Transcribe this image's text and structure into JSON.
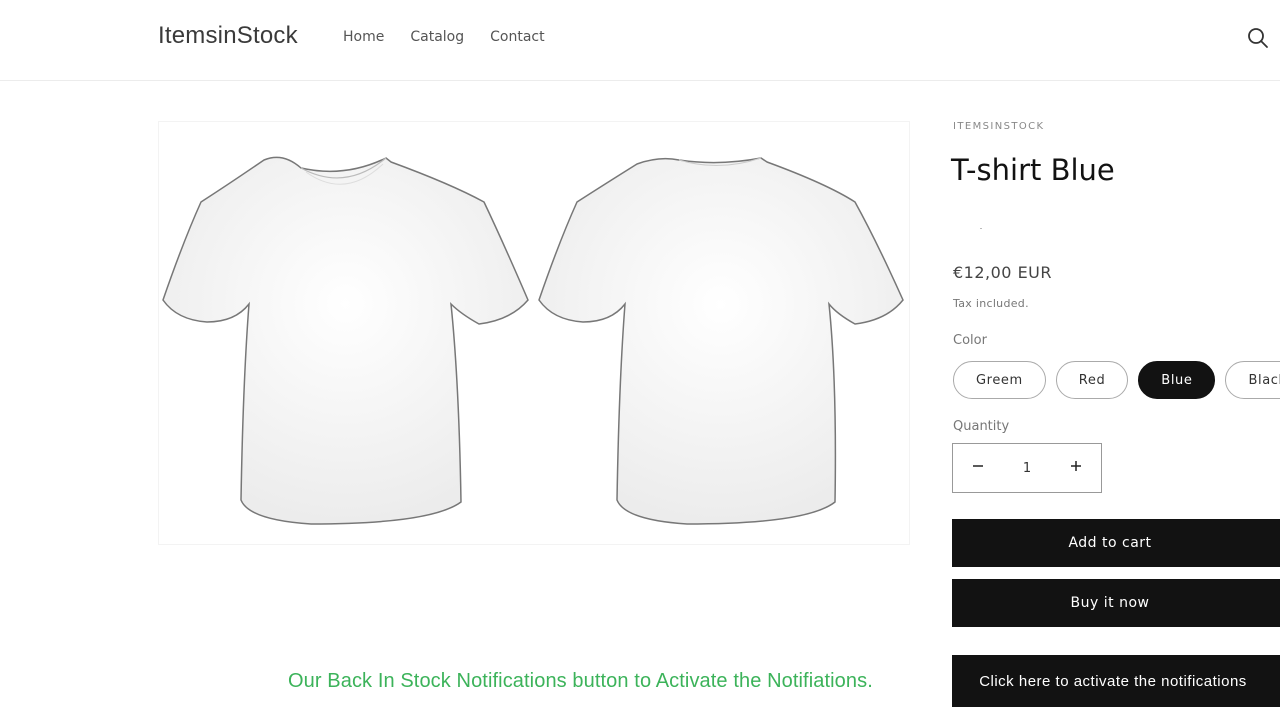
{
  "header": {
    "logo": "ItemsinStock",
    "nav": [
      "Home",
      "Catalog",
      "Contact"
    ],
    "search_icon": "search-icon"
  },
  "product": {
    "vendor": "ITEMSINSTOCK",
    "title": "T-shirt Blue",
    "price": "€12,00 EUR",
    "tax_note": "Tax included.",
    "image_alt": "White t-shirt front and back view",
    "color": {
      "label": "Color",
      "options": [
        "Greem",
        "Red",
        "Blue",
        "Black"
      ],
      "selected": "Blue"
    },
    "quantity": {
      "label": "Quantity",
      "value": "1",
      "decrease_icon": "minus-icon",
      "increase_icon": "plus-icon"
    },
    "buttons": {
      "add_to_cart": "Add to cart",
      "buy_now": "Buy it now",
      "notify": "Click here to activate the notifications"
    }
  },
  "caption": "Our Back In Stock Notifications button to Activate the Notifiations.",
  "colors": {
    "accent": "#121212",
    "caption": "#3cb35a"
  }
}
